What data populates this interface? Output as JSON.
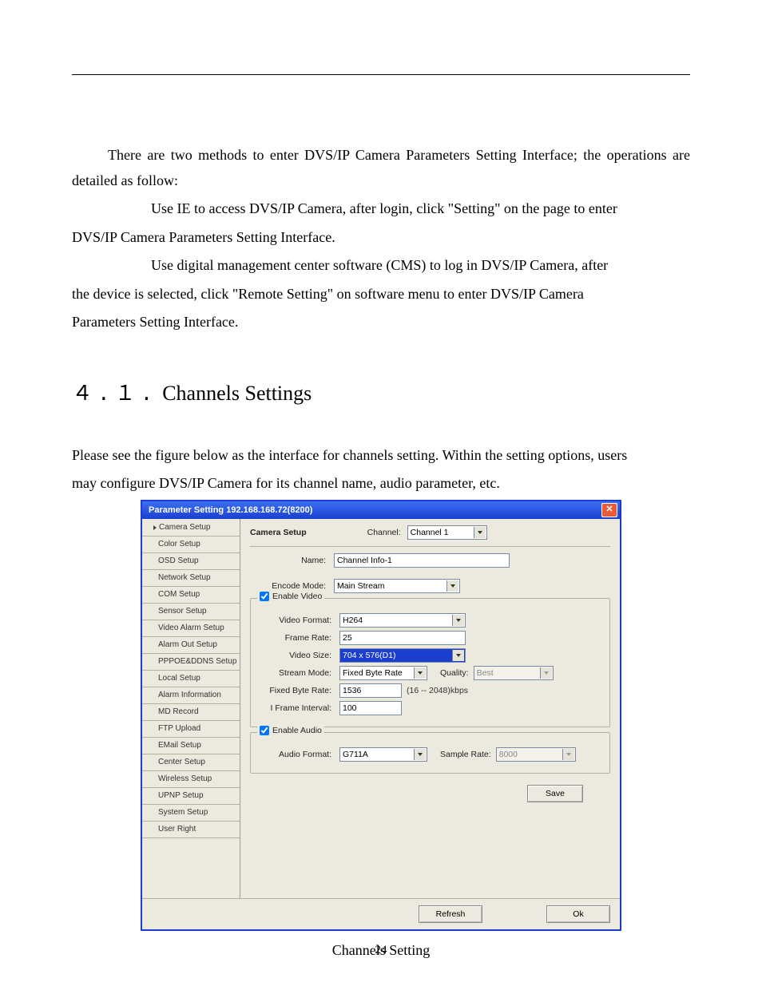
{
  "text": {
    "p1": "There are two methods to enter DVS/IP Camera Parameters Setting Interface; the operations are detailed as follow:",
    "p2": "Use IE to access DVS/IP Camera, after login, click \"Setting\" on the page to enter",
    "p2b": "DVS/IP Camera Parameters Setting Interface.",
    "p3": "Use digital management center software (CMS) to log in DVS/IP Camera, after",
    "p3b": "the device is selected, click \"Remote Setting\" on software menu to enter DVS/IP Camera",
    "p3c": "Parameters Setting Interface.",
    "p4": "Please see the figure below as the interface for channels setting. Within the setting options, users",
    "p4b": "may configure DVS/IP Camera for its channel name, audio parameter, etc."
  },
  "heading": {
    "num": "４.１.",
    "title": "Channels Settings"
  },
  "dialog": {
    "title": "Parameter Setting 192.168.168.72(8200)",
    "sidebar": [
      "Camera Setup",
      "Color Setup",
      "OSD Setup",
      "Network Setup",
      "COM Setup",
      "Sensor Setup",
      "Video Alarm Setup",
      "Alarm Out Setup",
      "PPPOE&DDNS Setup",
      "Local Setup",
      "Alarm Information",
      "MD Record",
      "FTP Upload",
      "EMail Setup",
      "Center Setup",
      "Wireless Setup",
      "UPNP Setup",
      "System Setup",
      "User Right"
    ],
    "panel": {
      "title": "Camera Setup",
      "channel_label": "Channel:",
      "channel_value": "Channel 1",
      "name_label": "Name:",
      "name_value": "Channel Info-1",
      "encode_mode_label": "Encode Mode:",
      "encode_mode_value": "Main Stream",
      "enable_video_label": "Enable Video",
      "video_format_label": "Video Format:",
      "video_format_value": "H264",
      "frame_rate_label": "Frame Rate:",
      "frame_rate_value": "25",
      "video_size_label": "Video Size:",
      "video_size_value": "704 x 576(D1)",
      "stream_mode_label": "Stream Mode:",
      "stream_mode_value": "Fixed Byte Rate",
      "quality_label": "Quality:",
      "quality_value": "Best",
      "fixed_byte_rate_label": "Fixed Byte Rate:",
      "fixed_byte_rate_value": "1536",
      "byte_rate_hint": "(16 -- 2048)kbps",
      "iframe_interval_label": "I Frame Interval:",
      "iframe_interval_value": "100",
      "enable_audio_label": "Enable Audio",
      "audio_format_label": "Audio Format:",
      "audio_format_value": "G711A",
      "sample_rate_label": "Sample Rate:",
      "sample_rate_value": "8000"
    },
    "buttons": {
      "save": "Save",
      "refresh": "Refresh",
      "ok": "Ok"
    }
  },
  "caption": "Channels Setting",
  "page_number": "24"
}
